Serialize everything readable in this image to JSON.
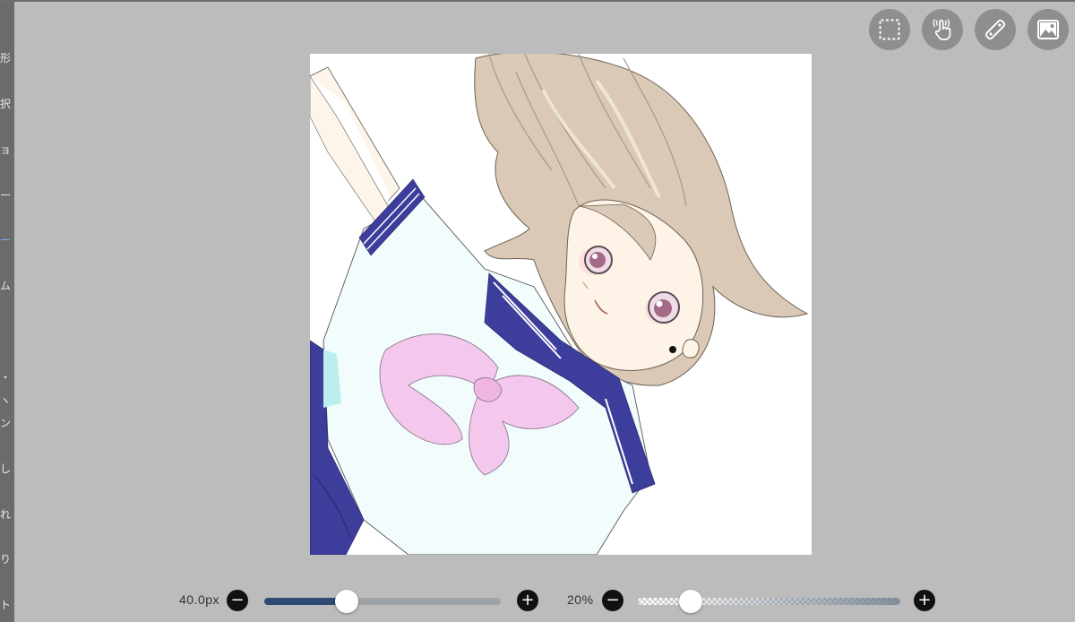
{
  "sidebar": {
    "items": [
      {
        "label": "形",
        "active": false
      },
      {
        "label": "択",
        "active": false
      },
      {
        "label": "ョ",
        "active": false
      },
      {
        "label": "ー",
        "active": false
      },
      {
        "label": "ー",
        "active": true
      },
      {
        "label": "ム",
        "active": false
      },
      {
        "label": "・",
        "active": false
      },
      {
        "label": "ヽ",
        "active": false
      },
      {
        "label": "ン",
        "active": false
      },
      {
        "label": "し",
        "active": false
      },
      {
        "label": "れ",
        "active": false
      },
      {
        "label": "り",
        "active": false
      },
      {
        "label": "ト",
        "active": false
      }
    ]
  },
  "toolbar": {
    "buttons": [
      {
        "icon": "selection-icon"
      },
      {
        "icon": "touch-gesture-icon"
      },
      {
        "icon": "ruler-icon"
      },
      {
        "icon": "image-icon"
      }
    ]
  },
  "canvas": {
    "content": "illustration"
  },
  "brush_size": {
    "label": "40.0px",
    "decrease": "−",
    "increase": "+",
    "slider_fraction": 0.35
  },
  "opacity": {
    "label": "20%",
    "decrease": "−",
    "increase": "+",
    "slider_fraction": 0.2
  },
  "colors": {
    "background": "#bcbcbc",
    "sidebar": "#6b6b6b",
    "accent": "#2d4a72",
    "button": "#8e8e8e"
  }
}
